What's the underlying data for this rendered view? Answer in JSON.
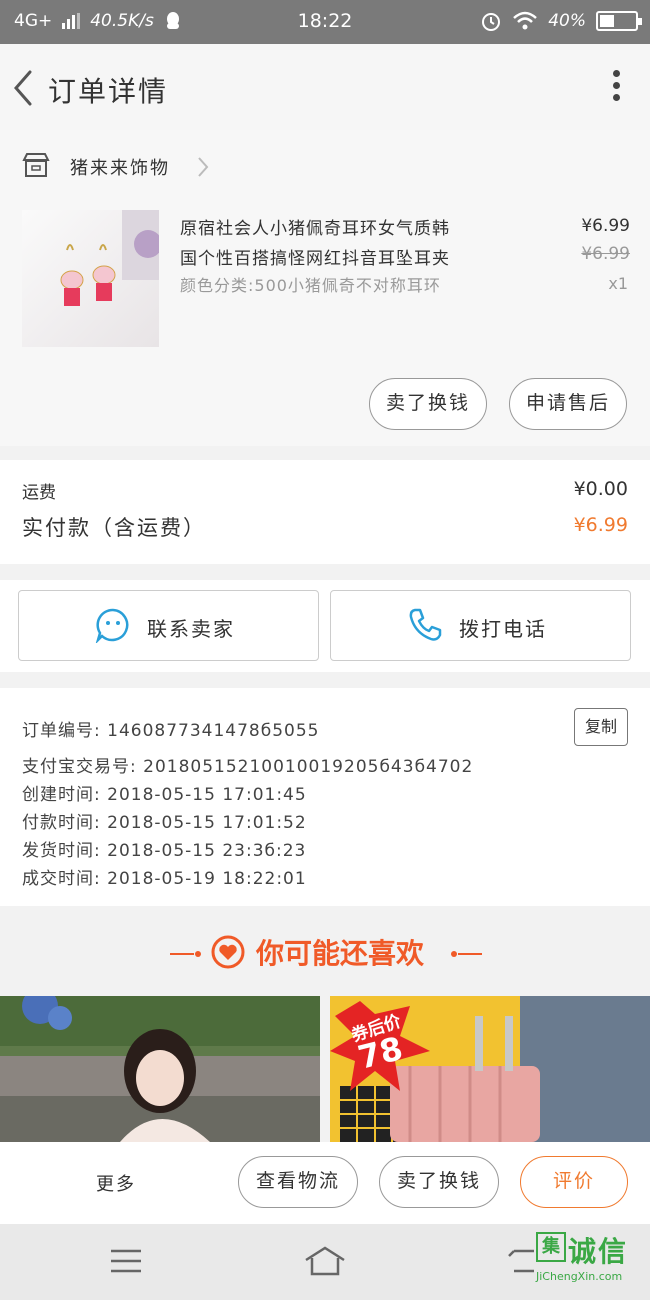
{
  "status_bar": {
    "network": "4G+",
    "speed": "40.5K/s",
    "time": "18:22",
    "battery_text": "40%",
    "battery_level": 0.4
  },
  "header": {
    "title": "订单详情"
  },
  "shop": {
    "name": "猪来来饰物"
  },
  "item": {
    "title_line1": "原宿社会人小猪佩奇耳环女气质韩",
    "title_line2": "国个性百搭搞怪网红抖音耳坠耳夹",
    "spec": "颜色分类:500小猪佩奇不对称耳环",
    "price": "¥6.99",
    "original_price": "¥6.99",
    "quantity": "x1"
  },
  "item_actions": {
    "return_label": "卖了换钱",
    "after_sale_label": "申请售后"
  },
  "fees": {
    "shipping_label": "运费",
    "shipping_value": "¥0.00",
    "paid_label": "实付款（含运费）",
    "paid_value": "¥6.99"
  },
  "contact": {
    "seller_label": "联系卖家",
    "phone_label": "拨打电话"
  },
  "order_info": {
    "order_no": "订单编号: 1460877341478б5055",
    "alipay_no": "支付宝交易号: 20180515210010019205б43б4702",
    "created": "创建时间: 2018-05-15 17:01:45",
    "paid": "付款时间: 2018-05-15 17:01:52",
    "shipped": "发货时间: 2018-05-15 23:3б:23",
    "completed": "成交时间: 2018-05-19 18:22:01",
    "copy_label": "复制"
  },
  "recommend": {
    "title": "你可能还喜欢",
    "badge_text": "券后价",
    "badge_price": "78"
  },
  "bottom_bar": {
    "more_label": "更多",
    "logistics_label": "查看物流",
    "sell_label": "卖了换钱",
    "review_label": "评价"
  },
  "watermark": {
    "brand": "集诚信",
    "url": "JiChengXin.com"
  },
  "colors": {
    "accent": "#f07a2f",
    "recommend": "#f05a28",
    "status_bar": "#7a7a7a",
    "contact_icon": "#2a9fd8"
  }
}
